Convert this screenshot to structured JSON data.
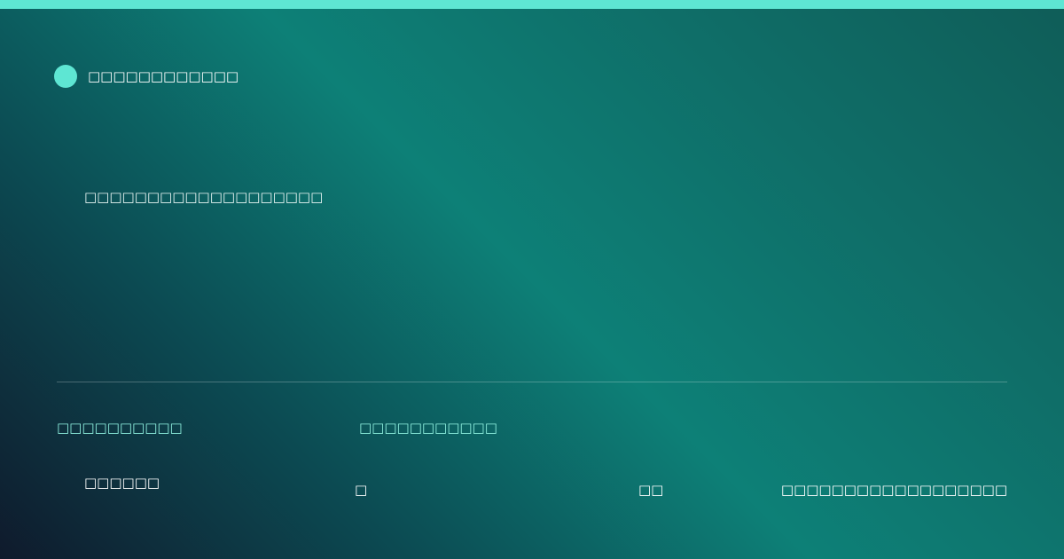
{
  "brand": {
    "name": "□□□□□□□□□□□□"
  },
  "headline": "□□□□□□□□□□□□□□□□□□□",
  "meta": {
    "label_1": "□□□□□□□□□□",
    "label_2": "□□□□□□□□□□□"
  },
  "footer": {
    "author": "□□□□□□",
    "separator": "□",
    "time": "□□",
    "url": "□□□□□□□□□□□□□□□□□□"
  },
  "colors": {
    "accent": "#5ee6d3",
    "label": "#8ff0df"
  }
}
